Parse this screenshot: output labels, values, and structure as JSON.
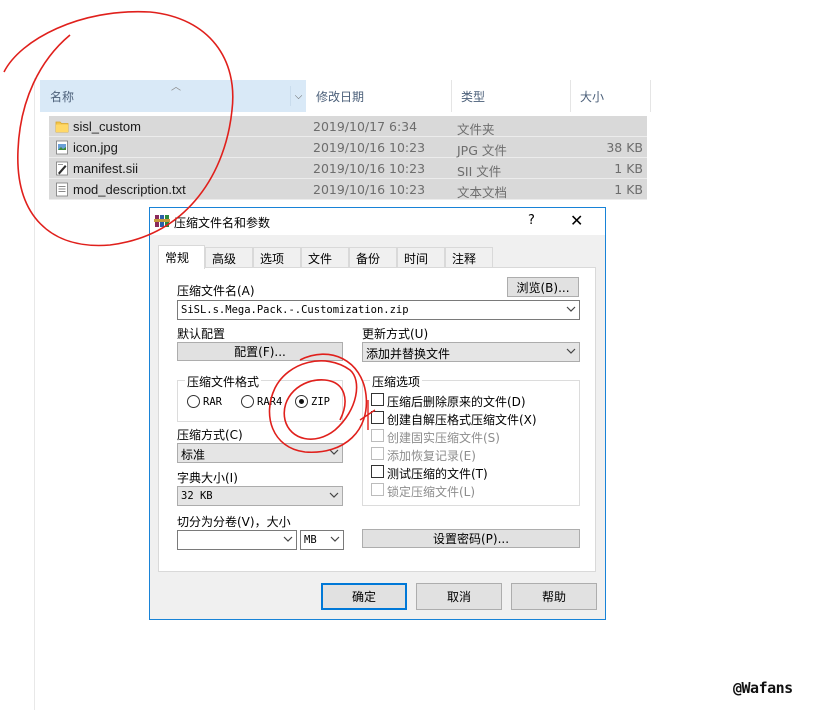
{
  "explorer": {
    "columns": {
      "name": "名称",
      "modified": "修改日期",
      "type": "类型",
      "size": "大小"
    },
    "files": [
      {
        "name": "sisl_custom",
        "modified": "2019/10/17 6:34",
        "type": "文件夹",
        "size": "",
        "icon": "folder-icon"
      },
      {
        "name": "icon.jpg",
        "modified": "2019/10/16 10:23",
        "type": "JPG 文件",
        "size": "38 KB",
        "icon": "image-file-icon"
      },
      {
        "name": "manifest.sii",
        "modified": "2019/10/16 10:23",
        "type": "SII 文件",
        "size": "1 KB",
        "icon": "sii-file-icon"
      },
      {
        "name": "mod_description.txt",
        "modified": "2019/10/16 10:23",
        "type": "文本文档",
        "size": "1 KB",
        "icon": "text-file-icon"
      }
    ]
  },
  "dialog": {
    "title": "压缩文件名和参数",
    "help": "?",
    "close": "✕",
    "tabs": [
      "常规",
      "高级",
      "选项",
      "文件",
      "备份",
      "时间",
      "注释"
    ],
    "archive_name_label": "压缩文件名(A)",
    "browse_button": "浏览(B)...",
    "archive_name_value": "SiSL.s.Mega.Pack.-.Customization.zip",
    "default_profile_label": "默认配置",
    "profiles_button": "配置(F)...",
    "update_mode_label": "更新方式(U)",
    "update_mode_value": "添加并替换文件",
    "format_label": "压缩文件格式",
    "formats": [
      {
        "label": "RAR",
        "selected": false
      },
      {
        "label": "RAR4",
        "selected": false
      },
      {
        "label": "ZIP",
        "selected": true
      }
    ],
    "options_label": "压缩选项",
    "options": [
      {
        "label": "压缩后删除原来的文件(D)",
        "checked": false,
        "enabled": true
      },
      {
        "label": "创建自解压格式压缩文件(X)",
        "checked": false,
        "enabled": true
      },
      {
        "label": "创建固实压缩文件(S)",
        "checked": false,
        "enabled": false
      },
      {
        "label": "添加恢复记录(E)",
        "checked": false,
        "enabled": false
      },
      {
        "label": "测试压缩的文件(T)",
        "checked": false,
        "enabled": true
      },
      {
        "label": "锁定压缩文件(L)",
        "checked": false,
        "enabled": false
      }
    ],
    "method_label": "压缩方式(C)",
    "method_value": "标准",
    "dict_label": "字典大小(I)",
    "dict_value": "32 KB",
    "split_label": "切分为分卷(V)，大小",
    "split_value": "",
    "split_unit": "MB",
    "password_button": "设置密码(P)...",
    "ok_button": "确定",
    "cancel_button": "取消",
    "help_button": "帮助"
  },
  "watermark": "@Wafans",
  "colors": {
    "selection": "#d9d9d9",
    "header_hover": "#d9e9f7",
    "dialog_border": "#1883d7",
    "annotation": "#e0201c"
  }
}
